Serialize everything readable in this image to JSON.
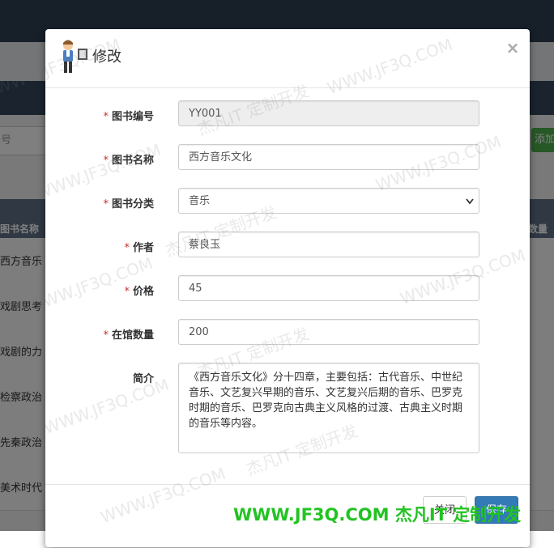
{
  "background": {
    "search_placeholder": "号",
    "add_button": "添加",
    "table_headers": [
      "图书名称",
      "数量"
    ],
    "rows": [
      "西方音乐",
      "戏剧思考",
      "戏剧的力",
      "检察政治",
      "先秦政治",
      "美术时代"
    ]
  },
  "modal": {
    "title": "修改",
    "close_symbol": "×",
    "fields": [
      {
        "required": "*",
        "label": "图书编号",
        "value": "YY001",
        "type": "disabled"
      },
      {
        "required": "*",
        "label": "图书名称",
        "value": "西方音乐文化",
        "type": "text"
      },
      {
        "required": "*",
        "label": "图书分类",
        "value": "音乐",
        "type": "select"
      },
      {
        "required": "*",
        "label": "作者",
        "value": "蔡良玉",
        "type": "text"
      },
      {
        "required": "*",
        "label": "价格",
        "value": "45",
        "type": "text"
      },
      {
        "required": "*",
        "label": "在馆数量",
        "value": "200",
        "type": "text"
      }
    ],
    "summary_label": "简介",
    "summary_value": "《西方音乐文化》分十四章，主要包括：古代音乐、中世纪音乐、文艺复兴早期的音乐、文艺复兴后期的音乐、巴罗克时期的音乐、巴罗克向古典主义风格的过渡、古典主义时期的音乐等内容。",
    "buttons": {
      "close": "关闭",
      "save": "保存"
    }
  },
  "watermarks": {
    "url": "WWW.JF3Q.COM",
    "cn": "杰凡IT 定制开发",
    "bottom": "WWW.JF3Q.COM 杰凡IT 定制开发"
  },
  "colors": {
    "primary": "#337ab7",
    "required": "#c9302c",
    "watermark_green": "#22c322"
  }
}
